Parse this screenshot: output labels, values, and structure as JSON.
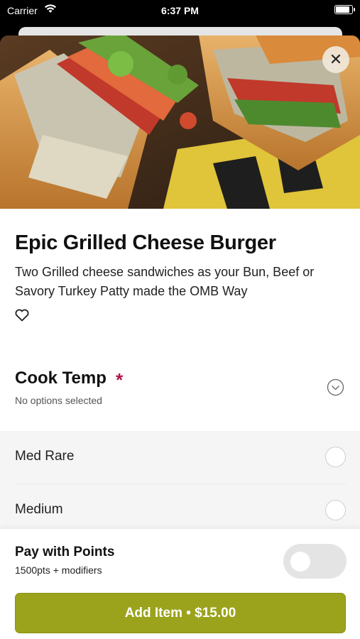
{
  "status_bar": {
    "carrier": "Carrier",
    "time": "6:37 PM",
    "icons": [
      "wifi-icon",
      "battery-icon"
    ]
  },
  "item": {
    "title": "Epic Grilled Cheese Burger",
    "description": "Two Grilled cheese sandwiches as your Bun, Beef or Savory Turkey Patty made the OMB Way",
    "favorite_icon": "heart-outline-icon",
    "close_icon": "close-icon"
  },
  "modifier_group": {
    "title": "Cook Temp",
    "required_marker": "*",
    "subtitle": "No options selected",
    "expand_icon": "chevron-down-circle-icon",
    "options": [
      {
        "label": "Med Rare",
        "selected": false
      },
      {
        "label": "Medium",
        "selected": false
      }
    ]
  },
  "points": {
    "title": "Pay with Points",
    "subtitle": "1500pts + modifiers",
    "enabled": false
  },
  "add_button": {
    "label": "Add Item • $15.00"
  },
  "colors": {
    "accent": "#9aa31b",
    "required": "#b0144a",
    "option_bg": "#f5f5f5"
  }
}
